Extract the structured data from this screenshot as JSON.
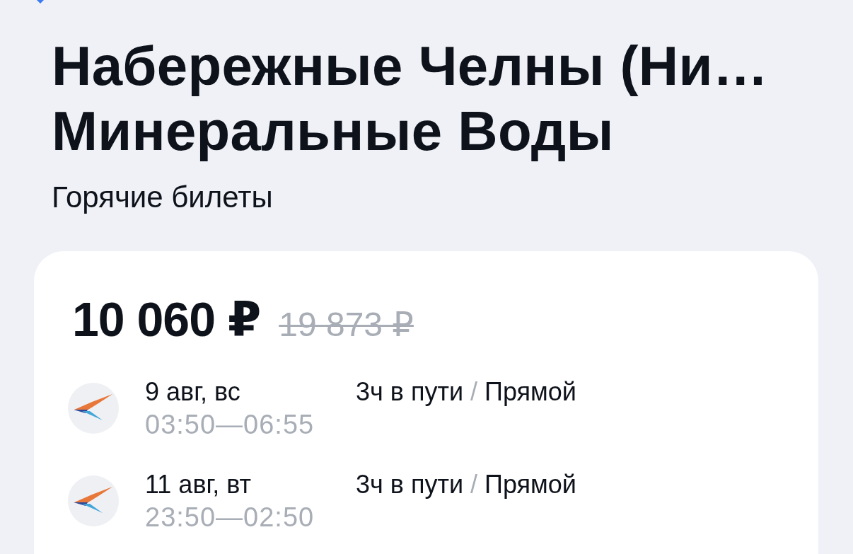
{
  "route": {
    "origin": "Набережные Челны (Ни…",
    "destination": "Минеральные Воды",
    "subtitle": "Горячие билеты"
  },
  "deal": {
    "price": "10 060 ₽",
    "old_price": "19 873 ₽",
    "flights": [
      {
        "date": "9 авг, вс",
        "times": "03:50—06:55",
        "duration": "3ч в пути",
        "separator": "/",
        "stops": "Прямой"
      },
      {
        "date": "11 авг, вт",
        "times": "23:50—02:50",
        "duration": "3ч в пути",
        "separator": "/",
        "stops": "Прямой"
      }
    ]
  }
}
